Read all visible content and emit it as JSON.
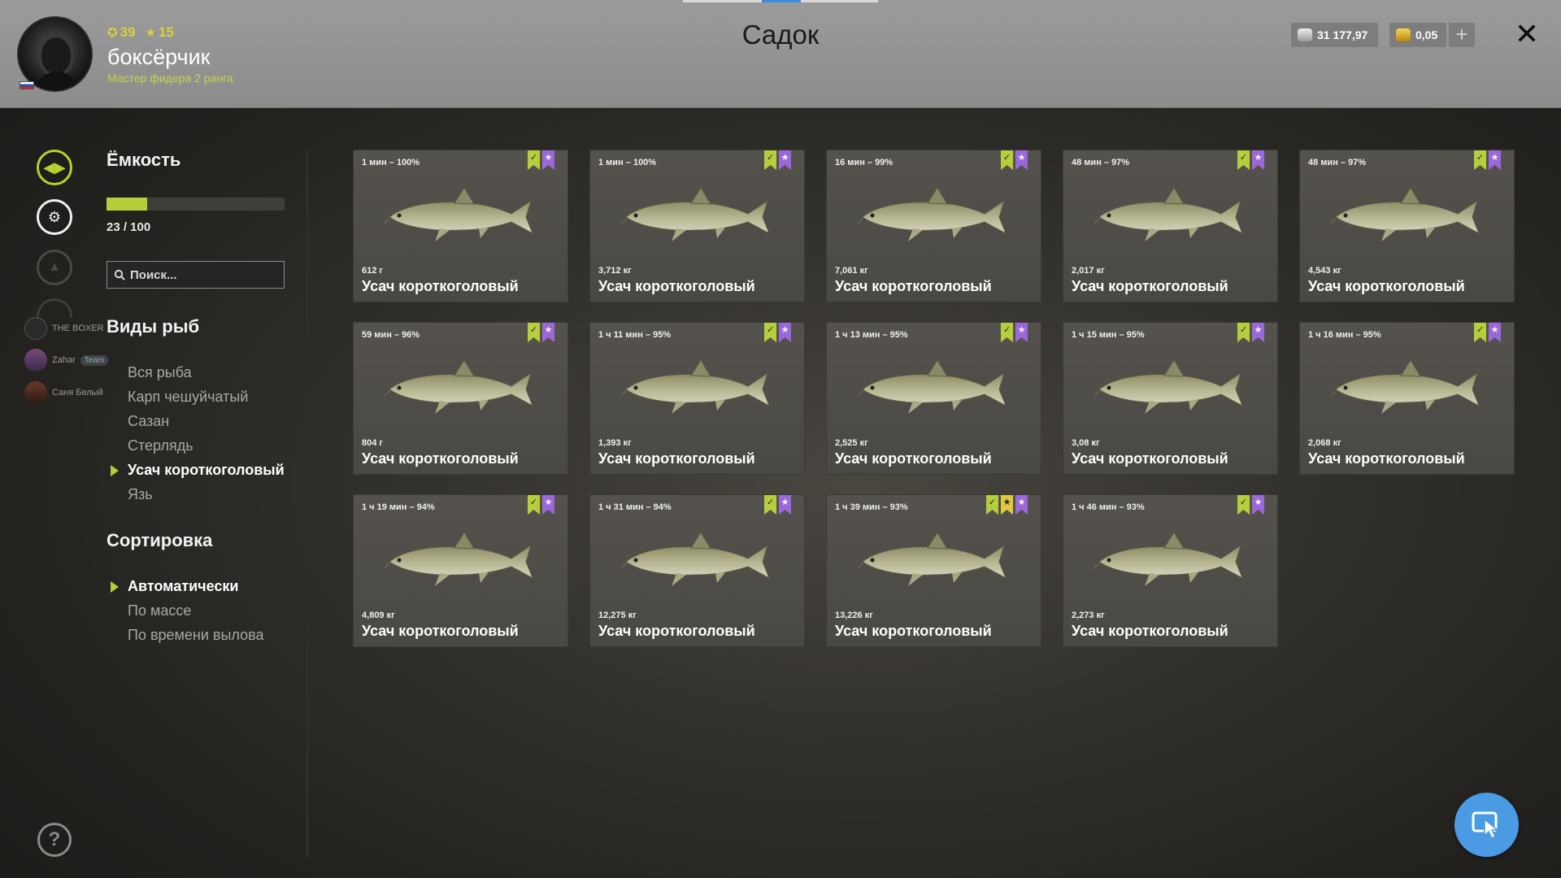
{
  "header": {
    "level": "39",
    "stars": "15",
    "username": "боксёрчик",
    "rank": "Мастер фидера 2 ранга",
    "title": "Садок",
    "silver": "31 177,97",
    "gold": "0,05",
    "plus_label": "+",
    "close_label": "✕"
  },
  "capacity": {
    "title": "Ёмкость",
    "current": 23,
    "max": 100,
    "text": "23 / 100",
    "fill_fraction": 0.23
  },
  "search": {
    "placeholder": "Поиск..."
  },
  "friends": [
    {
      "name": "THE BOXER"
    },
    {
      "name": "Zahar",
      "badge": "Team"
    },
    {
      "name": "Саня Белый"
    }
  ],
  "species": {
    "title": "Виды рыб",
    "items": [
      "Вся рыба",
      "Карп чешуйчатый",
      "Сазан",
      "Стерлядь",
      "Усач коротко­головый",
      "Язь"
    ],
    "selected_index": 4
  },
  "sorting": {
    "title": "Сортировка",
    "items": [
      "Автоматически",
      "По массе",
      "По времени вылова"
    ],
    "selected_index": 0
  },
  "fish_cards": [
    {
      "time": "1 мин – 100%",
      "weight": "612 г",
      "name": "Усач короткоголовый",
      "marks": [
        "green",
        "purple"
      ]
    },
    {
      "time": "1 мин – 100%",
      "weight": "3,712 кг",
      "name": "Усач короткоголовый",
      "marks": [
        "green",
        "purple"
      ]
    },
    {
      "time": "16 мин – 99%",
      "weight": "7,061 кг",
      "name": "Усач короткоголовый",
      "marks": [
        "green",
        "purple"
      ]
    },
    {
      "time": "48 мин – 97%",
      "weight": "2,017 кг",
      "name": "Усач короткоголовый",
      "marks": [
        "green",
        "purple"
      ]
    },
    {
      "time": "48 мин – 97%",
      "weight": "4,543 кг",
      "name": "Усач короткоголовый",
      "marks": [
        "green",
        "purple"
      ]
    },
    {
      "time": "59 мин – 96%",
      "weight": "804 г",
      "name": "Усач короткоголовый",
      "marks": [
        "green",
        "purple"
      ]
    },
    {
      "time": "1 ч 11 мин – 95%",
      "weight": "1,393 кг",
      "name": "Усач короткоголовый",
      "marks": [
        "green",
        "purple"
      ]
    },
    {
      "time": "1 ч 13 мин – 95%",
      "weight": "2,525 кг",
      "name": "Усач короткоголовый",
      "marks": [
        "green",
        "purple"
      ]
    },
    {
      "time": "1 ч 15 мин – 95%",
      "weight": "3,08 кг",
      "name": "Усач короткоголовый",
      "marks": [
        "green",
        "purple"
      ]
    },
    {
      "time": "1 ч 16 мин – 95%",
      "weight": "2,068 кг",
      "name": "Усач короткоголовый",
      "marks": [
        "green",
        "purple"
      ]
    },
    {
      "time": "1 ч 19 мин – 94%",
      "weight": "4,809 кг",
      "name": "Усач короткоголовый",
      "marks": [
        "green",
        "purple"
      ]
    },
    {
      "time": "1 ч 31 мин – 94%",
      "weight": "12,275 кг",
      "name": "Усач короткоголовый",
      "marks": [
        "green",
        "purple"
      ]
    },
    {
      "time": "1 ч 39 мин – 93%",
      "weight": "13,226 кг",
      "name": "Усач короткоголовый",
      "marks": [
        "green",
        "gold",
        "purple"
      ]
    },
    {
      "time": "1 ч 46 мин – 93%",
      "weight": "2,273 кг",
      "name": "Усач короткоголовый",
      "marks": [
        "green",
        "purple"
      ]
    }
  ],
  "colors": {
    "accent_green": "#b6cd3c",
    "mark_purple": "#9a68d8",
    "mark_gold": "#e0c83c",
    "cursor_button": "#4a9be4"
  },
  "icons": {
    "rail": [
      "fish-keepnet-icon",
      "bait-trap-icon",
      "boat-icon",
      "locked-icon"
    ],
    "help": "help-icon",
    "cursor": "cursor-icon"
  }
}
